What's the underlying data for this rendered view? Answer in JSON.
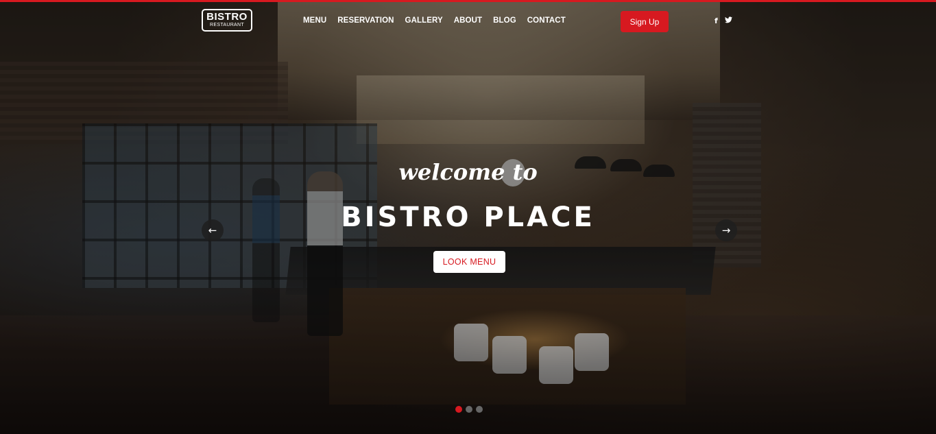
{
  "brand": {
    "name": "BISTRO",
    "tagline": "RESTAURANT"
  },
  "nav": {
    "items": [
      {
        "label": "MENU"
      },
      {
        "label": "RESERVATION"
      },
      {
        "label": "GALLERY"
      },
      {
        "label": "ABOUT"
      },
      {
        "label": "BLOG"
      },
      {
        "label": "CONTACT"
      }
    ]
  },
  "header": {
    "signup_label": "Sign Up",
    "social": [
      {
        "icon": "facebook-icon",
        "glyph": "f"
      },
      {
        "icon": "twitter-icon",
        "glyph": "t"
      }
    ]
  },
  "hero": {
    "welcome": "welcome to",
    "title": "BISTRO PLACE",
    "cta_label": "LOOK MENU",
    "prev_icon": "arrow-left-icon",
    "next_icon": "arrow-right-icon",
    "slides": [
      {
        "active": true
      },
      {
        "active": false
      },
      {
        "active": false
      }
    ]
  },
  "colors": {
    "accent": "#d71920",
    "text": "#ffffff",
    "inactive_dot": "#666666"
  }
}
